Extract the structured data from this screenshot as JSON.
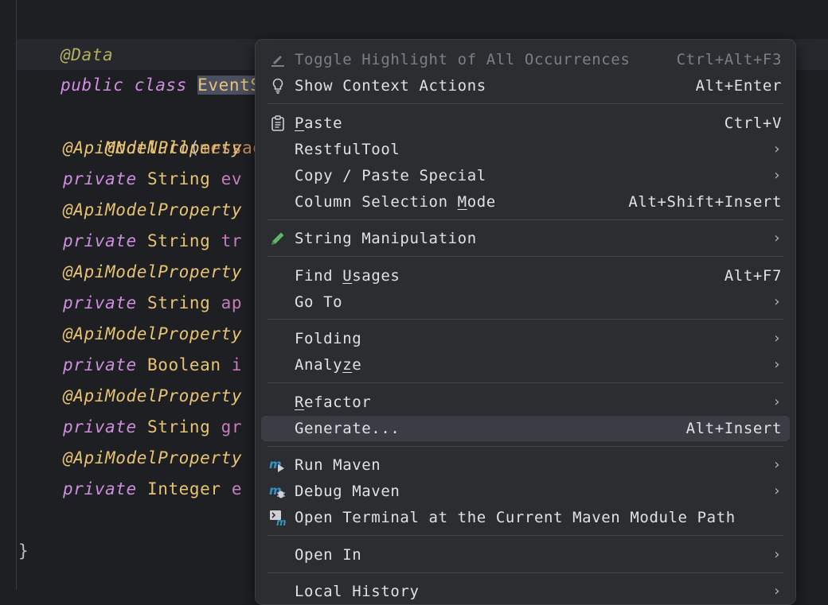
{
  "editor": {
    "line_data": {
      "annotation": "@Data"
    },
    "line_class": {
      "kw1": "public",
      "kw2": "class",
      "class_name": "EventSyn"
    },
    "fields": [
      {
        "annotation": "@NotNull",
        "paren": "(",
        "rest": "message"
      },
      {
        "annotation": "@ApiModelProperty",
        "kw": "private",
        "type": "String",
        "name": "ev"
      },
      {
        "annotation": "@ApiModelProperty",
        "kw": "private",
        "type": "String",
        "name": "tr"
      },
      {
        "annotation": "@ApiModelProperty",
        "kw": "private",
        "type": "String",
        "name": "ap"
      },
      {
        "annotation": "@ApiModelProperty",
        "kw": "private",
        "type": "Boolean",
        "name": "i"
      },
      {
        "annotation": "@ApiModelProperty",
        "kw": "private",
        "type": "String",
        "name": "gr"
      },
      {
        "annotation": "@ApiModelProperty",
        "kw": "private",
        "type": "Integer",
        "name": "e"
      }
    ],
    "closing_brace": "}"
  },
  "context_menu": {
    "items": [
      {
        "label": "Toggle Highlight of All Occurrences",
        "shortcut": "Ctrl+Alt+F3",
        "icon": "highlighter-icon",
        "disabled": true
      },
      {
        "label": "Show Context Actions",
        "shortcut": "Alt+Enter",
        "icon": "lightbulb-icon"
      },
      {
        "label_pre": "",
        "label_ul": "P",
        "label_post": "aste",
        "shortcut": "Ctrl+V",
        "icon": "clipboard-icon"
      },
      {
        "label": "RestfulTool",
        "submenu": true
      },
      {
        "label": "Copy / Paste Special",
        "submenu": true
      },
      {
        "label_pre": "Column Selection ",
        "label_ul": "M",
        "label_post": "ode",
        "shortcut": "Alt+Shift+Insert"
      },
      {
        "label": "String Manipulation",
        "submenu": true,
        "icon": "pencil-icon"
      },
      {
        "label_pre": "Find ",
        "label_ul": "U",
        "label_post": "sages",
        "shortcut": "Alt+F7"
      },
      {
        "label": "Go To",
        "submenu": true
      },
      {
        "label": "Folding",
        "submenu": true
      },
      {
        "label_pre": "Analy",
        "label_ul": "z",
        "label_post": "e",
        "submenu": true
      },
      {
        "label_pre": "",
        "label_ul": "R",
        "label_post": "efactor",
        "submenu": true
      },
      {
        "label": "Generate...",
        "shortcut": "Alt+Insert",
        "hovered": true
      },
      {
        "label": "Run Maven",
        "submenu": true,
        "icon": "maven-run-icon"
      },
      {
        "label": "Debug Maven",
        "submenu": true,
        "icon": "maven-debug-icon"
      },
      {
        "label": "Open Terminal at the Current Maven Module Path",
        "icon": "maven-terminal-icon"
      },
      {
        "label": "Open In",
        "submenu": true
      },
      {
        "label": "Local History",
        "submenu": true
      }
    ],
    "submenu_arrow": "›"
  },
  "colors": {
    "editor_bg": "#1e1f22",
    "menu_bg": "#2b2d30",
    "hover_bg": "#3a3d44",
    "annotation": "#b3ae60",
    "keyword": "#cf8ee0",
    "type": "#e8c371",
    "field": "#c77dbb",
    "maven_blue": "#3592c4",
    "pencil_green": "#5fb865"
  }
}
